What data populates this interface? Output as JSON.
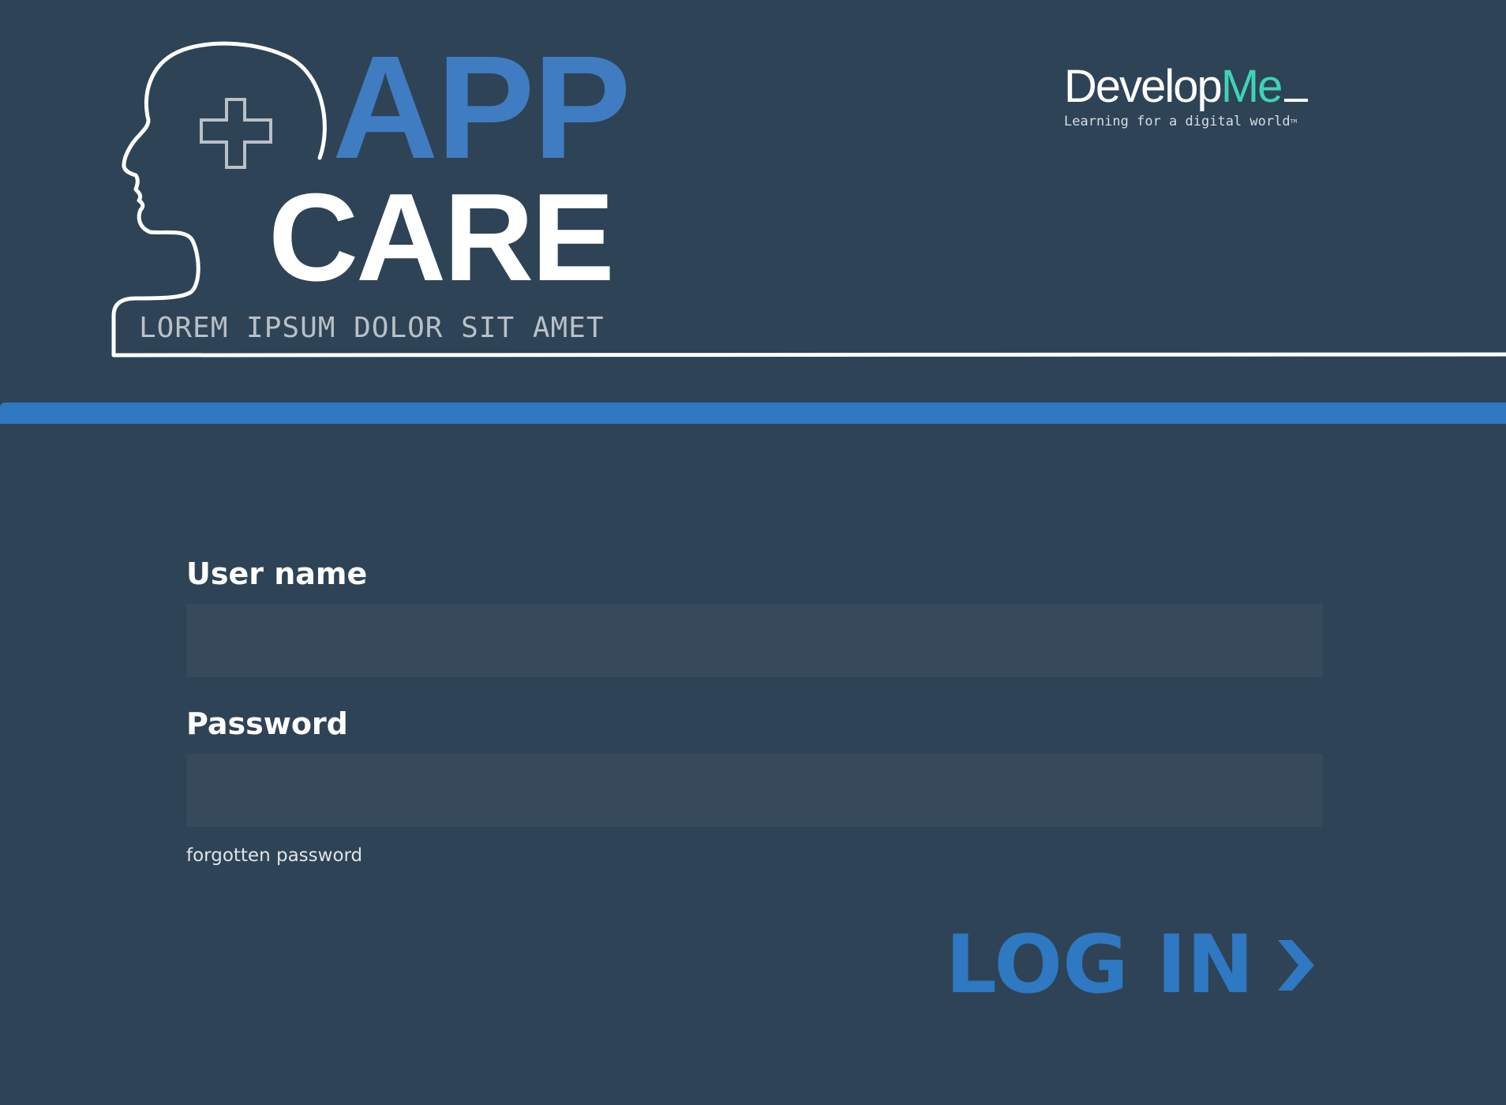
{
  "logo": {
    "word_top": "APP",
    "word_bottom": "CARE",
    "tagline": "LOREM IPSUM DOLOR SIT AMET",
    "head_icon": "head-outline-icon",
    "cross_icon": "medical-cross-icon"
  },
  "brand": {
    "name_primary": "Develop",
    "name_accent": "Me",
    "tagline": "Learning for a digital world",
    "trademark": "TM"
  },
  "form": {
    "username_label": "User name",
    "username_value": "",
    "password_label": "Password",
    "password_value": "",
    "forgot_link": "forgotten password",
    "login_label": "LOG IN",
    "login_icon": "chevron-right-icon"
  },
  "colors": {
    "background": "#2e4356",
    "accent_blue": "#2f78c2",
    "app_blue": "#3f7cc2",
    "brand_teal": "#3fd3b6",
    "input_bg": "#374a5b"
  }
}
